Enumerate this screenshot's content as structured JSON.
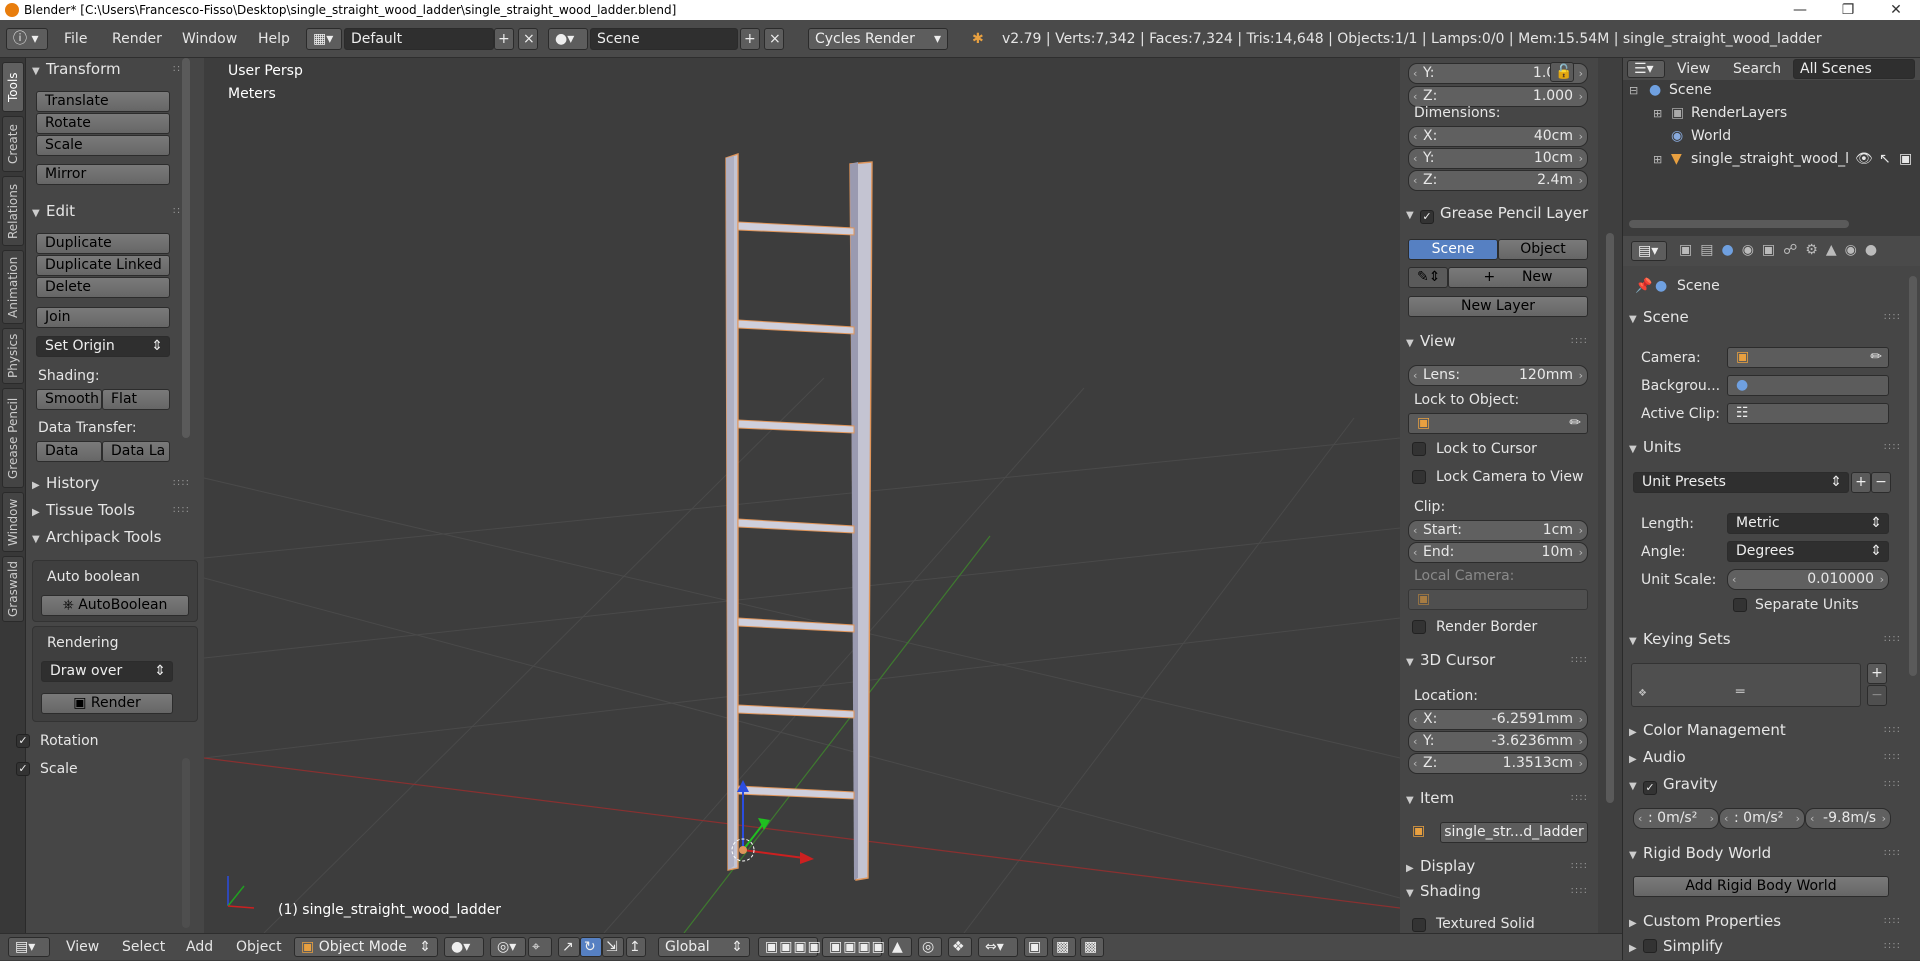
{
  "window": {
    "title": "Blender* [C:\\Users\\Francesco-Fisso\\Desktop\\single_straight_wood_ladder\\single_straight_wood_ladder.blend]"
  },
  "menu": {
    "file": "File",
    "render": "Render",
    "window": "Window",
    "help": "Help"
  },
  "layout": {
    "screen": "Default",
    "scene": "Scene",
    "engine": "Cycles Render"
  },
  "stats": "v2.79 | Verts:7,342 | Faces:7,324 | Tris:14,648 | Objects:1/1 | Lamps:0/0 | Mem:15.54M | single_straight_wood_ladder",
  "lefttabs": [
    "Tools",
    "Create",
    "Relations",
    "Animation",
    "Physics",
    "Grease Pencil",
    "Window",
    "Graswald"
  ],
  "toolshelf": {
    "transform": {
      "title": "Transform",
      "translate": "Translate",
      "rotate": "Rotate",
      "scale": "Scale",
      "mirror": "Mirror"
    },
    "edit": {
      "title": "Edit",
      "duplicate": "Duplicate",
      "duplicate_linked": "Duplicate Linked",
      "delete": "Delete",
      "join": "Join",
      "set_origin": "Set Origin",
      "shading_label": "Shading:",
      "smooth": "Smooth",
      "flat": "Flat",
      "data_transfer_label": "Data Transfer:",
      "data": "Data",
      "data_la": "Data La"
    },
    "history": "History",
    "tissue": "Tissue Tools",
    "archipack": {
      "title": "Archipack Tools",
      "auto_boolean_label": "Auto boolean",
      "auto_boolean_btn": "AutoBoolean",
      "rendering_label": "Rendering",
      "draw_over": "Draw over",
      "render_btn": "Render"
    },
    "rotation": "Rotation",
    "scale_chk": "Scale"
  },
  "viewport": {
    "persp": "User Persp",
    "units": "Meters",
    "object_label": "(1) single_straight_wood_ladder"
  },
  "npanel": {
    "scale_y": {
      "label": "Y:",
      "value": "1.000"
    },
    "scale_z": {
      "label": "Z:",
      "value": "1.000"
    },
    "dimensions_label": "Dimensions:",
    "dim_x": {
      "label": "X:",
      "value": "40cm"
    },
    "dim_y": {
      "label": "Y:",
      "value": "10cm"
    },
    "dim_z": {
      "label": "Z:",
      "value": "2.4m"
    },
    "grease_pencil": "Grease Pencil Layer",
    "gp_scene": "Scene",
    "gp_object": "Object",
    "gp_new": "New",
    "gp_new_layer": "New Layer",
    "view": "View",
    "lens": {
      "label": "Lens:",
      "value": "120mm"
    },
    "lock_to_object": "Lock to Object:",
    "lock_to_cursor": "Lock to Cursor",
    "lock_camera": "Lock Camera to View",
    "clip": "Clip:",
    "clip_start": {
      "label": "Start:",
      "value": "1cm"
    },
    "clip_end": {
      "label": "End:",
      "value": "10m"
    },
    "local_camera": "Local Camera:",
    "render_border": "Render Border",
    "cursor3d": "3D Cursor",
    "location": "Location:",
    "cur_x": {
      "label": "X:",
      "value": "-6.2591mm"
    },
    "cur_y": {
      "label": "Y:",
      "value": "-3.6236mm"
    },
    "cur_z": {
      "label": "Z:",
      "value": "1.3513cm"
    },
    "item": "Item",
    "item_name": "single_str...d_ladder",
    "display": "Display",
    "shading": "Shading",
    "textured_solid": "Textured Solid"
  },
  "outliner": {
    "view": "View",
    "search": "Search",
    "all_scenes": "All Scenes",
    "scene": "Scene",
    "renderlayers": "RenderLayers",
    "world": "World",
    "object": "single_straight_wood_l"
  },
  "props": {
    "context": "Scene",
    "scene_panel": "Scene",
    "camera": "Camera:",
    "background": "Backgrou...",
    "active_clip": "Active Clip:",
    "units_panel": "Units",
    "unit_presets": "Unit Presets",
    "length": "Length:",
    "length_val": "Metric",
    "angle": "Angle:",
    "angle_val": "Degrees",
    "unit_scale": "Unit Scale:",
    "unit_scale_val": "0.010000",
    "separate_units": "Separate Units",
    "keying_sets": "Keying Sets",
    "color_management": "Color Management",
    "audio": "Audio",
    "gravity": "Gravity",
    "grav_x": ": 0m/s²",
    "grav_y": ": 0m/s²",
    "grav_z": "-9.8m/s",
    "rigid_body_world": "Rigid Body World",
    "add_rigid_body_world": "Add Rigid Body World",
    "custom_properties": "Custom Properties",
    "simplify": "Simplify"
  },
  "bottombar": {
    "view": "View",
    "select": "Select",
    "add": "Add",
    "object": "Object",
    "mode": "Object Mode",
    "orientation": "Global"
  }
}
